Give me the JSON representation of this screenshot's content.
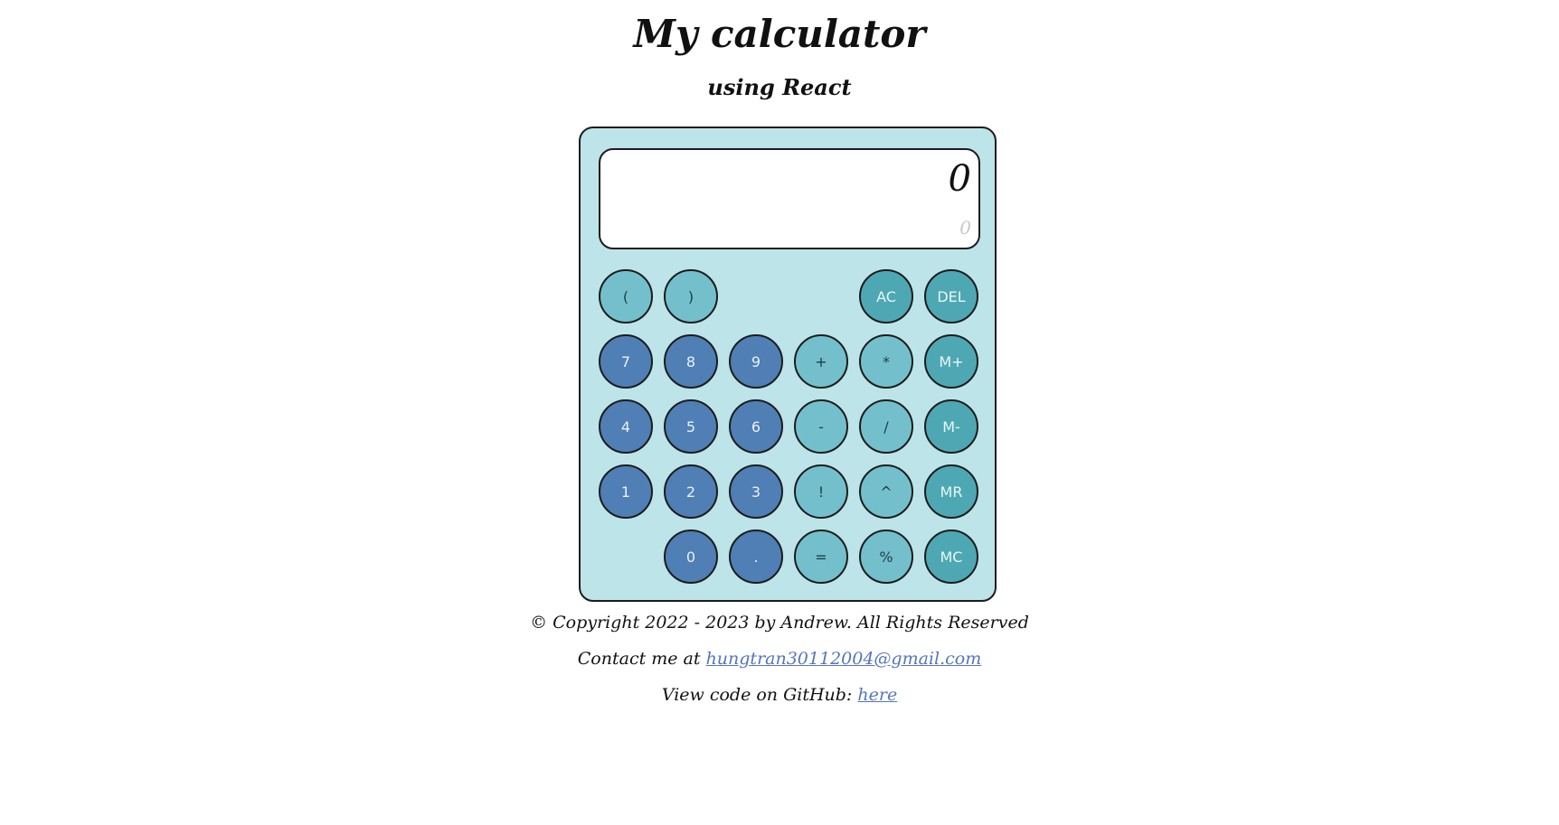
{
  "title": "My calculator",
  "subtitle": "using React",
  "display": {
    "main": "0",
    "sub": "0"
  },
  "keys": {
    "open_paren": "(",
    "close_paren": ")",
    "ac": "AC",
    "del": "DEL",
    "seven": "7",
    "eight": "8",
    "nine": "9",
    "plus": "+",
    "multiply": "*",
    "m_plus": "M+",
    "four": "4",
    "five": "5",
    "six": "6",
    "minus": "-",
    "divide": "/",
    "m_minus": "M-",
    "one": "1",
    "two": "2",
    "three": "3",
    "factorial": "!",
    "power": "^",
    "mr": "MR",
    "zero": "0",
    "dot": ".",
    "equals": "=",
    "percent": "%",
    "mc": "MC"
  },
  "footer": {
    "copyright": "© Copyright 2022 - 2023 by Andrew. All Rights Reserved",
    "contact_prefix": "Contact me at ",
    "contact_email": "hungtran30112004@gmail.com",
    "github_prefix": "View code on GitHub: ",
    "github_link": "here"
  },
  "colors": {
    "calculator_body": "#bde4e8",
    "number_key": "#4f7fb4",
    "operator_key": "#73c0cc",
    "control_key": "#4ea8b3",
    "link": "#5576b8"
  }
}
